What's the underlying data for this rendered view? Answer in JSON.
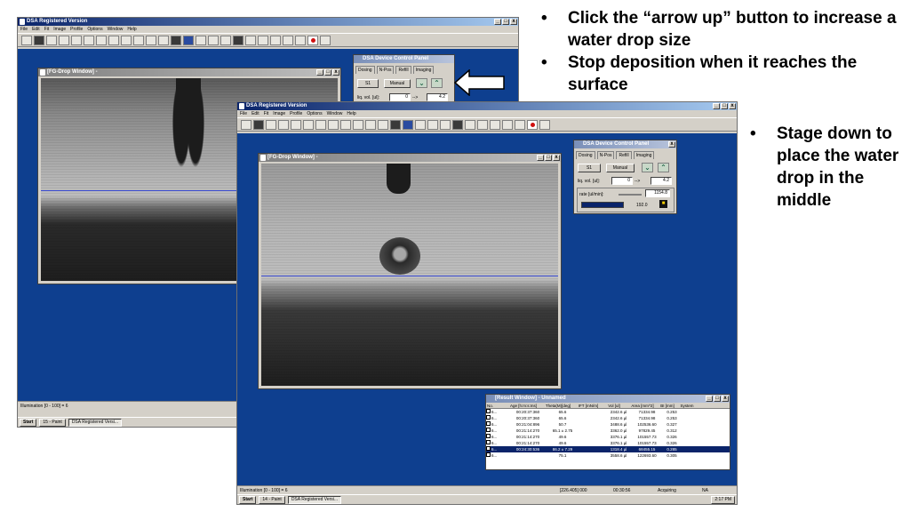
{
  "instructions": {
    "bullet_1": "Click the “arrow up” button to increase a water drop size",
    "bullet_2": "Stop deposition when it reaches the surface",
    "bullet_3": "Stage down to place the water drop in the middle"
  },
  "back_screenshot": {
    "title": "DSA Registered Version",
    "menu": [
      "File",
      "Edit",
      "Fit",
      "Image",
      "Profile",
      "Options",
      "Window",
      "Help"
    ],
    "drop_window_title": "[FG-Drop Window] -",
    "control_panel": {
      "title": "DSA Device Control Panel",
      "tabs": [
        "Dosing",
        "N-Pos",
        "Refill",
        "Imaging"
      ],
      "syringe": "S1",
      "mode": "Manual",
      "liq_vol_label": "liq. vol. [ul]:",
      "liq_vol_value": "0",
      "arrow": "-->",
      "liq_vol_target": "4.2"
    },
    "status": "Illumination [0 - 100] = 6",
    "taskbar": {
      "start": "Start",
      "item_1": "15 - Paint",
      "item_2": "DSA Registered Versi..."
    }
  },
  "front_screenshot": {
    "title": "DSA Registered Version",
    "menu": [
      "File",
      "Edit",
      "Fit",
      "Image",
      "Profile",
      "Options",
      "Window",
      "Help"
    ],
    "drop_window_title": "[FG-Drop Window] -",
    "control_panel": {
      "title": "DSA Device Control Panel",
      "tabs": [
        "Dosing",
        "N-Pos",
        "Refill",
        "Imaging"
      ],
      "syringe": "S1",
      "mode": "Manual",
      "liq_vol_label": "liq. vol. [ul]:",
      "liq_vol_value": "0",
      "arrow": "-->",
      "liq_vol_target": "4.2",
      "rate_label": "rate [ul/min]:",
      "rate_value": "1154.8",
      "level_value": "192.0"
    },
    "result_window": {
      "title": "[Result Window] - Unnamed",
      "columns": [
        "No.",
        "Age [h:m:s:ms]",
        "Theta(M)[deg]",
        "IFT [mN/m]",
        "Vol [ul]",
        "Area [mm^2]",
        "BI [mm]",
        "System"
      ],
      "rows": [
        [
          "6...",
          "00:20:37:360",
          "65.6",
          "",
          "2342.6 µl",
          "71334.98",
          "0.253",
          ""
        ],
        [
          "6...",
          "00:20:37:360",
          "65.6",
          "",
          "2342.6 µl",
          "71334.98",
          "0.253",
          ""
        ],
        [
          "6...",
          "00:21:04:896",
          "50.7",
          "",
          "3488.6 µl",
          "102536.60",
          "0.327",
          ""
        ],
        [
          "6...",
          "00:21:14:270",
          "65.1 ± 2.75",
          "",
          "3362.0 µl",
          "97829.45",
          "0.312",
          ""
        ],
        [
          "6...",
          "00:21:14:270",
          "49.6",
          "",
          "3376.1 µl",
          "101557.73",
          "0.326",
          ""
        ],
        [
          "6...",
          "00:21:14:270",
          "49.6",
          "",
          "3376.1 µl",
          "101557.73",
          "0.326",
          ""
        ],
        [
          "6...",
          "00:24:30:536",
          "86.2 ± 7.29",
          "",
          "1318.4 µl",
          "68455.15",
          "0.285",
          ""
        ],
        [
          "6...",
          "",
          "75.1",
          "",
          "3558.6 µl",
          "122693.60",
          "0.305",
          ""
        ]
      ]
    },
    "status": {
      "left": "Illumination [0 - 100] = 6",
      "coords": "[226.405] 000",
      "time": "00:30:56",
      "state": "Acquiring",
      "na": "NA"
    },
    "taskbar": {
      "start": "Start",
      "item_1": "14 - Paint",
      "item_2": "DSA Registered Versi...",
      "clock": "2:17 PM"
    }
  }
}
